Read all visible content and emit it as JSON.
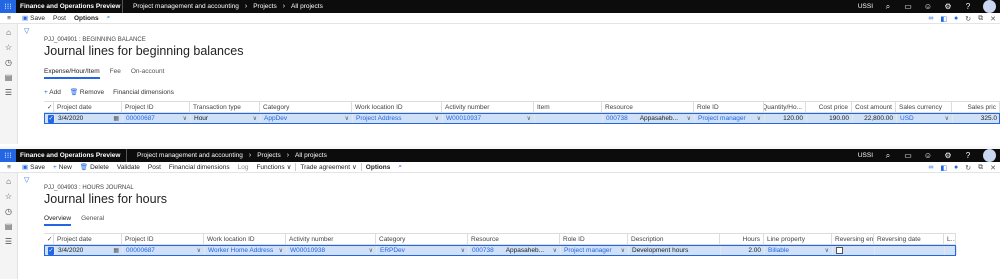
{
  "app": {
    "name": "Finance and Operations Preview",
    "company": "USSI",
    "breadcrumb": [
      "Project management and accounting",
      "Projects",
      "All projects"
    ],
    "accent": "#2266e3"
  },
  "pane1": {
    "actions": {
      "save": "Save",
      "post": "Post",
      "options": "Options"
    },
    "caption": "PJJ_004901 : BEGINNING BALANCE",
    "title": "Journal lines for beginning balances",
    "tabs": [
      "Expense/Hour/Item",
      "Fee",
      "On-account"
    ],
    "gridactions": {
      "add": "Add",
      "remove": "Remove",
      "financial": "Financial dimensions"
    },
    "headers": [
      "Project date",
      "Project ID",
      "Transaction type",
      "Category",
      "Work location ID",
      "Activity number",
      "Item",
      "Resource",
      "Role ID",
      "Quantity/Ho...",
      "Cost price",
      "Cost amount",
      "Sales currency",
      "Sales pric"
    ],
    "row": {
      "date": "3/4/2020",
      "project": "00000687",
      "type": "Hour",
      "category": "AppDev",
      "location": "Project Address",
      "activity": "W00010937",
      "item": "",
      "resource_id": "000738",
      "resource_name": "Appasaheb...",
      "role": "Project manager",
      "qty": "120.00",
      "cost_price": "190.00",
      "cost_amount": "22,800.00",
      "currency": "USD",
      "sales_price": "325.0"
    }
  },
  "pane2": {
    "actions": {
      "save": "Save",
      "new": "New",
      "delete": "Delete",
      "validate": "Validate",
      "post": "Post",
      "financial": "Financial dimensions",
      "log": "Log",
      "functions": "Functions",
      "trade": "Trade agreement",
      "options": "Options"
    },
    "caption": "PJJ_004903 : HOURS JOURNAL",
    "title": "Journal lines for hours",
    "tabs": [
      "Overview",
      "General"
    ],
    "headers": [
      "Project date",
      "Project ID",
      "Work location ID",
      "Activity number",
      "Category",
      "Resource",
      "Role ID",
      "Description",
      "Hours",
      "Line property",
      "Reversing en...",
      "Reversing date",
      "L..."
    ],
    "row": {
      "date": "3/4/2020",
      "project": "00000687",
      "location": "Worker Home Address",
      "activity": "W00010938",
      "category": "ERPDev",
      "resource_id": "000738",
      "resource_name": "Appasaheb...",
      "role": "Project manager",
      "description": "Development hours",
      "hours": "2.00",
      "line_property": "Billable",
      "reversing_date": ""
    }
  }
}
